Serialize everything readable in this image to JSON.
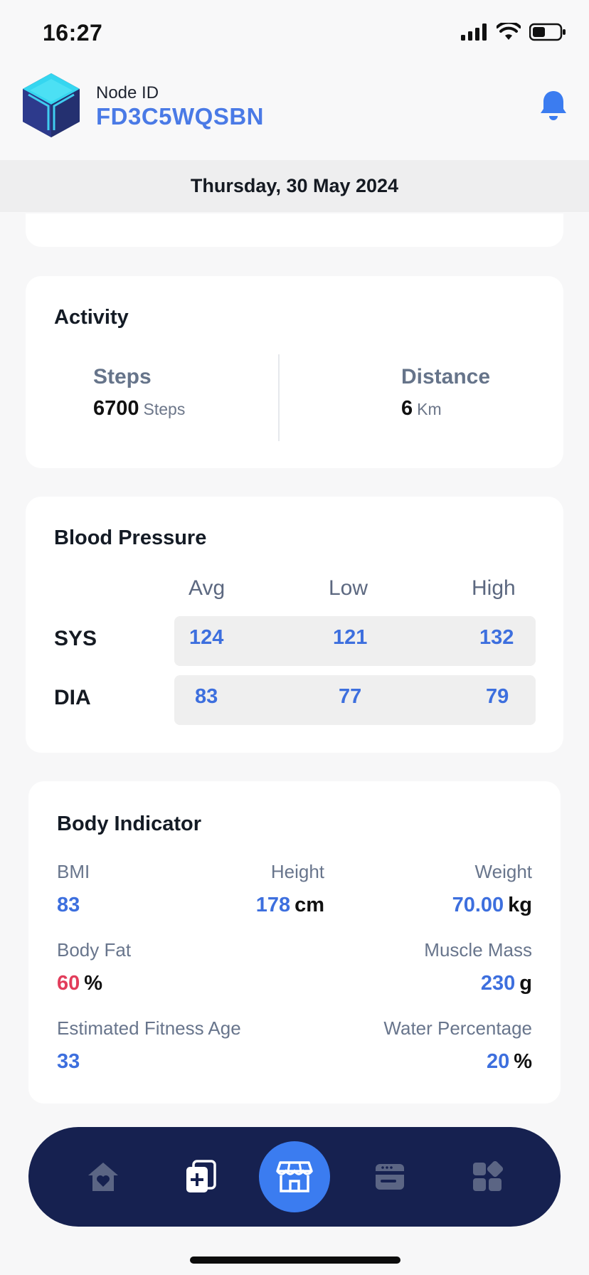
{
  "status_bar": {
    "time": "16:27"
  },
  "header": {
    "node_label": "Node ID",
    "node_id": "FD3C5WQSBN"
  },
  "date": "Thursday, 30 May 2024",
  "activity": {
    "title": "Activity",
    "steps": {
      "label": "Steps",
      "value": "6700",
      "unit": "Steps"
    },
    "distance": {
      "label": "Distance",
      "value": "6",
      "unit": "Km"
    }
  },
  "blood_pressure": {
    "title": "Blood Pressure",
    "columns": [
      "Avg",
      "Low",
      "High"
    ],
    "rows": [
      {
        "label": "SYS",
        "values": [
          "124",
          "121",
          "132"
        ]
      },
      {
        "label": "DIA",
        "values": [
          "83",
          "77",
          "79"
        ]
      }
    ]
  },
  "body_indicator": {
    "title": "Body Indicator",
    "bmi": {
      "label": "BMI",
      "value": "83"
    },
    "height": {
      "label": "Height",
      "value": "178",
      "unit": "cm"
    },
    "weight": {
      "label": "Weight",
      "value": "70.00",
      "unit": "kg"
    },
    "body_fat": {
      "label": "Body Fat",
      "value": "60",
      "unit": "%"
    },
    "muscle_mass": {
      "label": "Muscle Mass",
      "value": "230",
      "unit": "g"
    },
    "fitness_age": {
      "label": "Estimated Fitness Age",
      "value": "33"
    },
    "water": {
      "label": "Water Percentage",
      "value": "20",
      "unit": "%"
    }
  },
  "nav": {
    "items": [
      "home-heart-icon",
      "medical-records-icon",
      "store-icon",
      "wallet-card-icon",
      "apps-grid-icon"
    ],
    "active": "store-icon",
    "colors": {
      "bar": "#162150",
      "active": "#3b7cf0",
      "inactive": "#5b6584"
    }
  },
  "colors": {
    "accent": "#3d6fde",
    "alert": "#e23d5b"
  }
}
